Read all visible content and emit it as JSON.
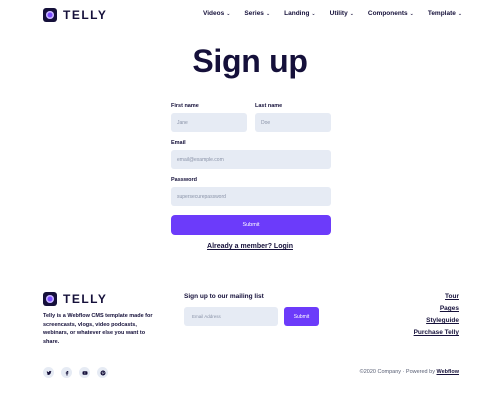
{
  "brand": {
    "name": "TELLY"
  },
  "nav": [
    {
      "label": "Videos"
    },
    {
      "label": "Series"
    },
    {
      "label": "Landing"
    },
    {
      "label": "Utility"
    },
    {
      "label": "Components"
    },
    {
      "label": "Template"
    }
  ],
  "page": {
    "title": "Sign up"
  },
  "form": {
    "first_name_label": "First name",
    "first_name_placeholder": "Jane",
    "last_name_label": "Last name",
    "last_name_placeholder": "Doe",
    "email_label": "Email",
    "email_placeholder": "email@example.com",
    "password_label": "Password",
    "password_placeholder": "supersecurepassword",
    "submit_label": "Submit",
    "login_link": "Already a member? Login"
  },
  "footer": {
    "brand": "TELLY",
    "description": "Telly is a Webflow CMS template made for screencasts, vlogs, video podcasts, webinars, or whatever else you want to share.",
    "mailing_title": "Sign up to our mailing list",
    "mailing_placeholder": "Email Address",
    "mailing_submit": "Submit",
    "links": [
      "Tour",
      "Pages",
      "Styleguide",
      "Purchase Telly"
    ],
    "socials": [
      "twitter-icon",
      "facebook-icon",
      "youtube-icon",
      "pinterest-icon"
    ],
    "copyright_prefix": "©2020 Company · Powered by ",
    "copyright_link": "Webflow"
  },
  "colors": {
    "primary": "#6c3bfa",
    "dark": "#15103a",
    "input_bg": "#e6ebf4"
  }
}
